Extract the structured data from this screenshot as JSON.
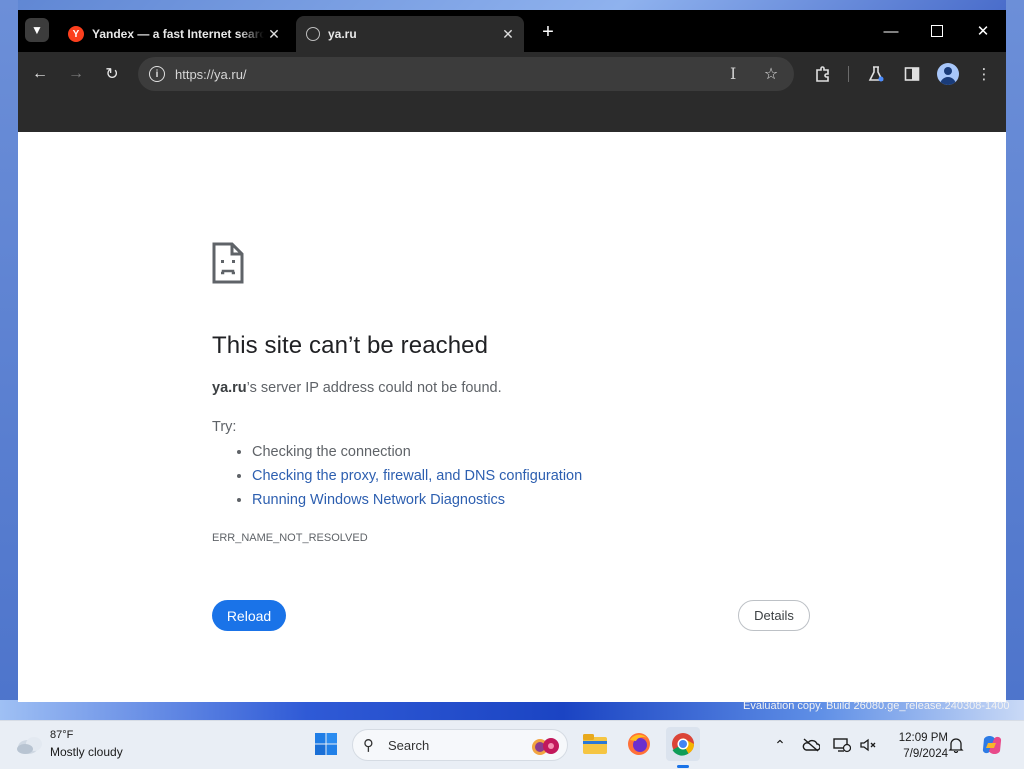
{
  "browser": {
    "tabs": [
      {
        "title": "Yandex — a fast Internet search",
        "favicon": "yandex-favicon",
        "active": false
      },
      {
        "title": "ya.ru",
        "favicon": "globe-icon",
        "active": true
      }
    ],
    "address_bar": {
      "url": "https://ya.ru/"
    },
    "colors": {
      "titlebar": "#000000",
      "toolbar": "#2b2b2b",
      "omnibox": "#3c3c3c"
    }
  },
  "error_page": {
    "title": "This site can’t be reached",
    "host": "ya.ru",
    "description_rest": "’s server IP address could not be found.",
    "try_label": "Try:",
    "suggestions": [
      {
        "text": "Checking the connection",
        "is_link": false
      },
      {
        "text": "Checking the proxy, firewall, and DNS configuration",
        "is_link": true
      },
      {
        "text": "Running Windows Network Diagnostics",
        "is_link": true
      }
    ],
    "error_code": "ERR_NAME_NOT_RESOLVED",
    "reload_label": "Reload",
    "details_label": "Details",
    "accent_color": "#1a73e8"
  },
  "desktop": {
    "watermark": "Evaluation copy. Build 26080.ge_release.240308-1400"
  },
  "taskbar": {
    "weather_temp": "87°F",
    "weather_condition": "Mostly cloudy",
    "search_label": "Search",
    "time": "12:09 PM",
    "date": "7/9/2024"
  }
}
